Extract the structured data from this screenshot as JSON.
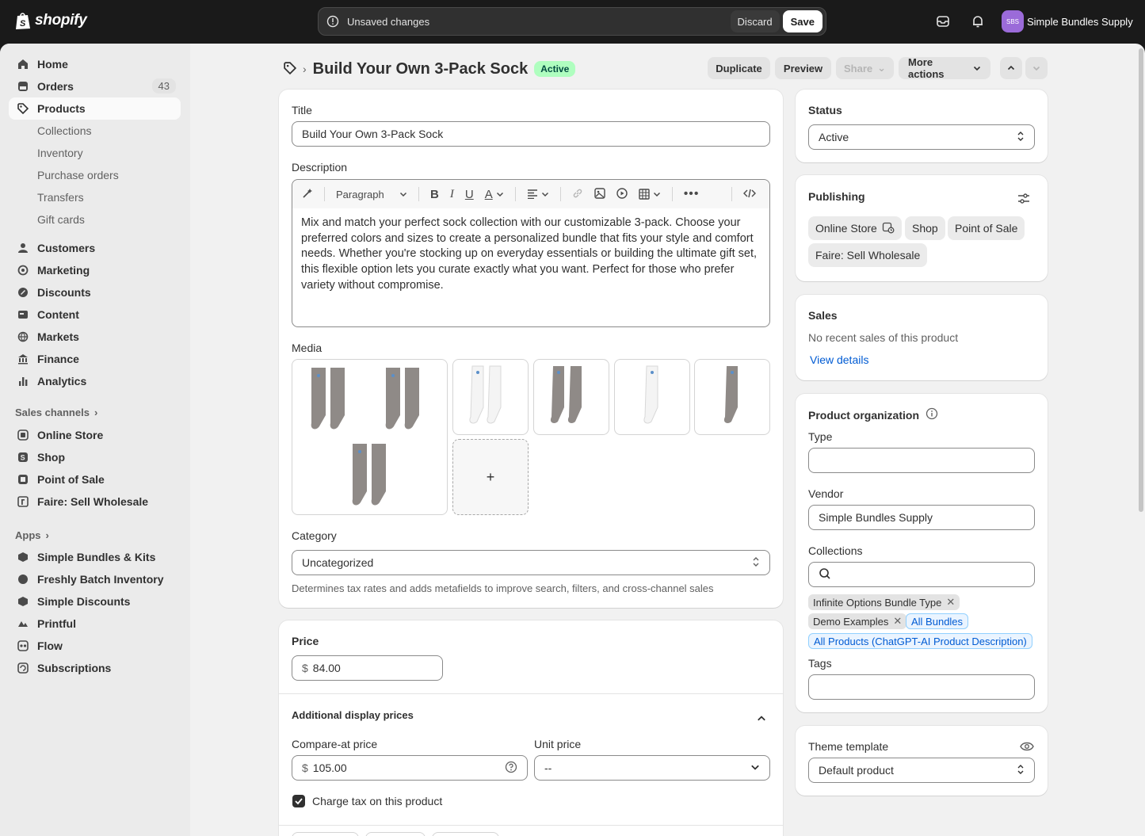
{
  "topbar": {
    "logo_text": "shopify",
    "unsaved_text": "Unsaved changes",
    "discard_label": "Discard",
    "save_label": "Save",
    "avatar_initials": "SBS",
    "store_name": "Simple Bundles Supply"
  },
  "sidebar": {
    "items": [
      {
        "label": "Home",
        "icon": "home-icon"
      },
      {
        "label": "Orders",
        "icon": "orders-icon",
        "badge": "43"
      },
      {
        "label": "Products",
        "icon": "tag-icon"
      }
    ],
    "product_subitems": [
      "Collections",
      "Inventory",
      "Purchase orders",
      "Transfers",
      "Gift cards"
    ],
    "more_items": [
      {
        "label": "Customers",
        "icon": "person-icon"
      },
      {
        "label": "Marketing",
        "icon": "target-icon"
      },
      {
        "label": "Discounts",
        "icon": "discount-icon"
      },
      {
        "label": "Content",
        "icon": "content-icon"
      },
      {
        "label": "Markets",
        "icon": "globe-icon"
      },
      {
        "label": "Finance",
        "icon": "bank-icon"
      },
      {
        "label": "Analytics",
        "icon": "chart-icon"
      }
    ],
    "sales_channels_label": "Sales channels",
    "channels": [
      "Online Store",
      "Shop",
      "Point of Sale",
      "Faire: Sell Wholesale"
    ],
    "apps_label": "Apps",
    "apps": [
      "Simple Bundles & Kits",
      "Freshly Batch Inventory",
      "Simple Discounts",
      "Printful",
      "Flow",
      "Subscriptions"
    ]
  },
  "header": {
    "title": "Build Your Own 3-Pack Sock",
    "status": "Active",
    "duplicate": "Duplicate",
    "preview": "Preview",
    "share": "Share",
    "more_actions": "More actions"
  },
  "main": {
    "title_label": "Title",
    "title_value": "Build Your Own 3-Pack Sock",
    "description_label": "Description",
    "paragraph_label": "Paragraph",
    "description_text": "Mix and match your perfect sock collection with our customizable 3-pack. Choose your preferred colors and sizes to create a personalized bundle that fits your style and comfort needs. Whether you're stocking up on everyday essentials or building the ultimate gift set, this flexible option lets you curate exactly what you want. Perfect for those who prefer variety without compromise.",
    "media_label": "Media",
    "media_add": "+",
    "category_label": "Category",
    "category_value": "Uncategorized",
    "category_help": "Determines tax rates and adds metafields to improve search, filters, and cross-channel sales"
  },
  "pricing": {
    "price_label": "Price",
    "currency": "$",
    "price_value": "84.00",
    "additional_label": "Additional display prices",
    "compare_label": "Compare-at price",
    "compare_value": "105.00",
    "unit_label": "Unit price",
    "unit_value": "--",
    "charge_tax_label": "Charge tax on this product"
  },
  "status_card": {
    "label": "Status",
    "value": "Active"
  },
  "publishing": {
    "label": "Publishing",
    "channels": [
      "Online Store",
      "Shop",
      "Point of Sale",
      "Faire: Sell Wholesale"
    ]
  },
  "sales": {
    "label": "Sales",
    "text": "No recent sales of this product",
    "link": "View details"
  },
  "organization": {
    "label": "Product organization",
    "type_label": "Type",
    "type_value": "",
    "vendor_label": "Vendor",
    "vendor_value": "Simple Bundles Supply",
    "collections_label": "Collections",
    "collection_tags": [
      "Infinite Options Bundle Type",
      "Demo Examples"
    ],
    "collection_links": [
      "All Bundles",
      "All Products (ChatGPT-AI Product Description)"
    ],
    "tags_label": "Tags"
  },
  "theme": {
    "label": "Theme template",
    "value": "Default product"
  },
  "colors": {
    "accent": "#005bd3",
    "active_badge": "#affebf",
    "topbar": "#1a1a1a"
  }
}
